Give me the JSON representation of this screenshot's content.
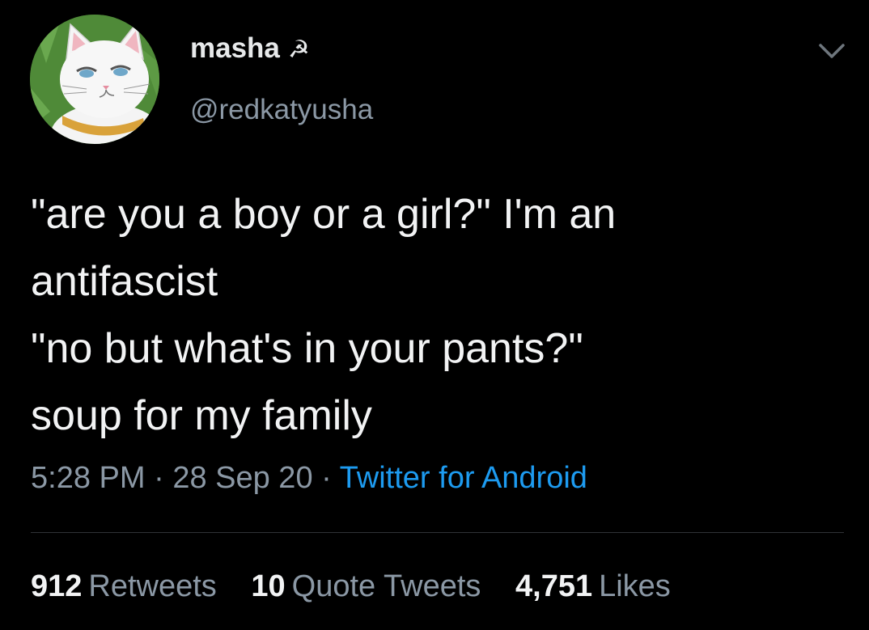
{
  "user": {
    "display_name": "masha",
    "name_emoji": "☭",
    "handle": "@redkatyusha"
  },
  "tweet": {
    "lines": [
      "\"are you a boy or a girl?\" I'm an",
      "antifascist",
      "\"no but what's in your pants?\"",
      "soup for my family"
    ],
    "time": "5:28 PM",
    "date": "28 Sep 20",
    "separator": "·",
    "source": "Twitter for Android"
  },
  "stats": {
    "retweets_count": "912",
    "retweets_label": "Retweets",
    "quotes_count": "10",
    "quotes_label": "Quote Tweets",
    "likes_count": "4,751",
    "likes_label": "Likes"
  },
  "icons": {
    "caret": "chevron-down-icon",
    "avatar": "white-cat-avatar"
  },
  "colors": {
    "background": "#000000",
    "text": "#e7e9ea",
    "secondary": "#8b98a5",
    "link": "#1d9bf0"
  }
}
